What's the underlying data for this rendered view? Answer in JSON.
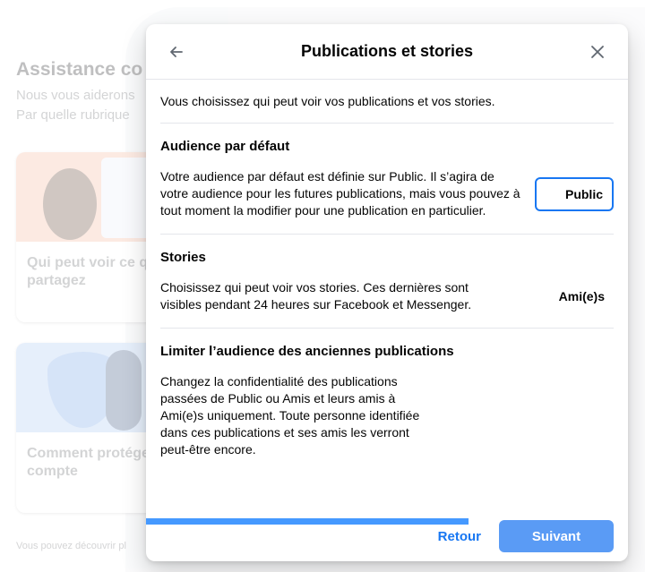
{
  "background": {
    "title": "Assistance co",
    "subtitle_1": "Nous vous aiderons",
    "subtitle_2": "Par quelle rubrique",
    "card_1_caption": "Qui peut voir ce q vous partagez",
    "card_2_caption": "Comment protége votre compte",
    "footer": "Vous pouvez découvrir pl"
  },
  "modal": {
    "title": "Publications et stories",
    "back_icon": "arrow-left-icon",
    "close_icon": "close-icon",
    "intro": "Vous choisissez qui peut voir vos publications et vos stories.",
    "sections": [
      {
        "title": "Audience par défaut",
        "description": "Votre audience par défaut est définie sur Public. Il s’agira de votre audience pour les futures publications, mais vous pouvez à tout moment la modifier pour une publication en particulier.",
        "value": "Public"
      },
      {
        "title": "Stories",
        "description": "Choisissez qui peut voir vos stories. Ces dernières sont visibles pendant 24 heures sur Facebook et Messenger.",
        "value": "Ami(e)s"
      },
      {
        "title": "Limiter l’audience des anciennes publications",
        "description": "Changez la confidentialité des publications passées de Public ou Amis et leurs amis à Ami(e)s uniquement. Toute personne identifiée dans ces publications et ses amis les verront peut-être encore."
      }
    ],
    "progress": 0.67,
    "footer": {
      "back_label": "Retour",
      "next_label": "Suivant"
    }
  },
  "colors": {
    "accent": "#1877f2",
    "progress": "#4599ff",
    "next_button": "#5a9bf5"
  }
}
